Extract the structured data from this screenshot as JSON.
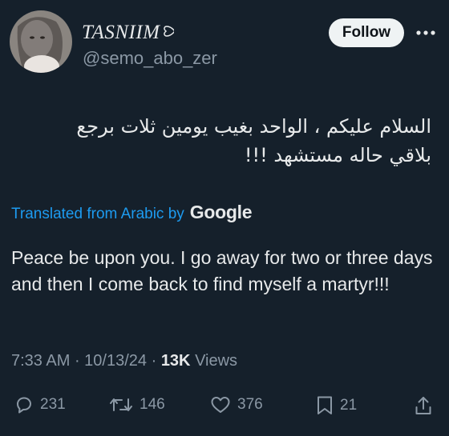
{
  "author": {
    "display_name": "TASNIIM",
    "handle": "@semo_abo_zer",
    "name_emoji_icon": "white-heart-icon"
  },
  "header": {
    "follow_label": "Follow",
    "more_icon": "more-horizontal-icon"
  },
  "tweet": {
    "arabic_text": "السلام عليكم ، الواحد بغيب يومين ثلات برجع\nبلاقي حاله  مستشهد !!!",
    "translated_label": "Translated from Arabic by",
    "translator": "Google",
    "translation": "Peace be upon you. I go away for two or three days and then I come back to find myself a martyr!!!"
  },
  "meta": {
    "time": "7:33 AM",
    "separator1": " · ",
    "date": "10/13/24",
    "separator2": " · ",
    "views_count": "13K",
    "views_label": " Views"
  },
  "actions": {
    "replies": "231",
    "reposts": "146",
    "likes": "376",
    "bookmarks": "21"
  },
  "colors": {
    "background": "#15202b",
    "text": "#e7e9ea",
    "secondary": "#8b98a5",
    "accent": "#1d9bf0"
  }
}
